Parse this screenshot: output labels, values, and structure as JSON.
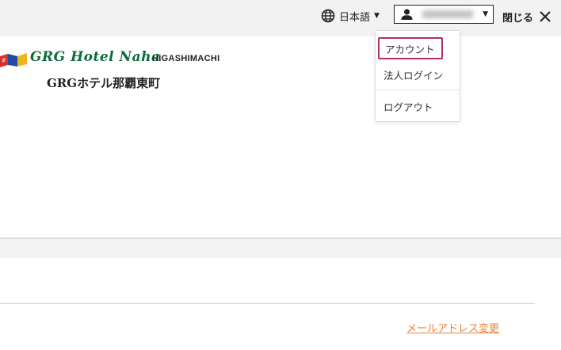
{
  "header": {
    "language": "日本語",
    "close_label": "閉じる"
  },
  "logo": {
    "script_text": "GRG Hotel Naha",
    "sub_text": "HIGASHIMACHI",
    "jp_text": "GRGホテル那覇東町"
  },
  "account_menu": {
    "items": [
      {
        "label": "アカウント"
      },
      {
        "label": "法人ログイン"
      },
      {
        "label": "ログアウト"
      }
    ]
  },
  "main": {
    "email_change_link": "メールアドレス変更"
  },
  "colors": {
    "highlight": "#b0306a",
    "link": "#e8823a",
    "logo_green": "#0d6b3a"
  },
  "icons": [
    "globe-icon",
    "user-icon",
    "close-icon",
    "flag-logo"
  ]
}
